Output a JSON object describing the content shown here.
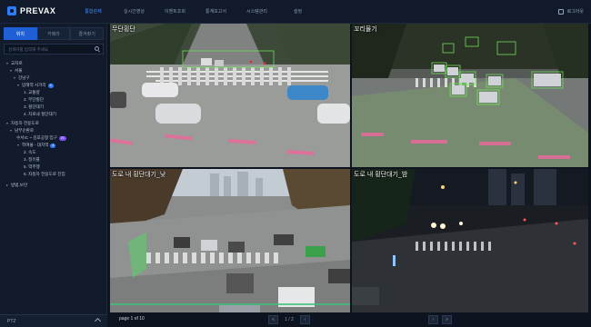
{
  "app": {
    "name": "PREVAX",
    "logout_label": "로그아웃"
  },
  "nav": [
    "통합관제",
    "실시간영상",
    "이벤트조회",
    "통계보고서",
    "시스템관리",
    "설정"
  ],
  "sidebar": {
    "tabs": [
      "위치",
      "카메라",
      "즐겨찾기"
    ],
    "search_placeholder": "검색어를 입력해 주세요",
    "tree": [
      {
        "label": "교차로",
        "caret": "▾"
      },
      {
        "label": "서울",
        "caret": "▾"
      },
      {
        "label": "강남구",
        "caret": "▾"
      },
      {
        "label": "압해역 사거리",
        "caret": "▾",
        "badge": "4"
      },
      {
        "label": "1. 교통량",
        "caret": ""
      },
      {
        "label": "2. 무단횡단",
        "caret": ""
      },
      {
        "label": "3. 횡단대기",
        "caret": ""
      },
      {
        "label": "4. 차로내 횡단대기",
        "caret": ""
      },
      {
        "label": "자동차 전용도로",
        "caret": "▾"
      },
      {
        "label": "남부순환로",
        "caret": "▾"
      },
      {
        "label": "수서IC ~ 김포공항 입구",
        "caret": "",
        "badge": "21",
        "badge_color": "purple"
      },
      {
        "label": "학여울 - 대치역",
        "caret": "▾",
        "badge": "4"
      },
      {
        "label": "2. 속도",
        "caret": ""
      },
      {
        "label": "3. 정유률",
        "caret": ""
      },
      {
        "label": "5. 역주행",
        "caret": ""
      },
      {
        "label": "6. 자동차 전용도로 진입",
        "caret": ""
      },
      {
        "label": "방범,보안",
        "caret": "▸"
      }
    ],
    "ptz_label": "PTZ"
  },
  "cameras": [
    {
      "label": "무단횡단",
      "selected": true
    },
    {
      "label": "꼬리물기",
      "selected": false
    },
    {
      "label": "도로 내 횡단대기_낮",
      "selected": false
    },
    {
      "label": "도로 내 횡단대기_밤",
      "selected": false
    }
  ],
  "pager": {
    "info": "page 1 of 10",
    "current": "1 / 2",
    "first": "«",
    "prev": "‹",
    "next": "›",
    "last": "»"
  },
  "colors": {
    "accent": "#2f7bff",
    "selected_border": "#d8a72a",
    "detect_box": "#6fdc5a"
  }
}
